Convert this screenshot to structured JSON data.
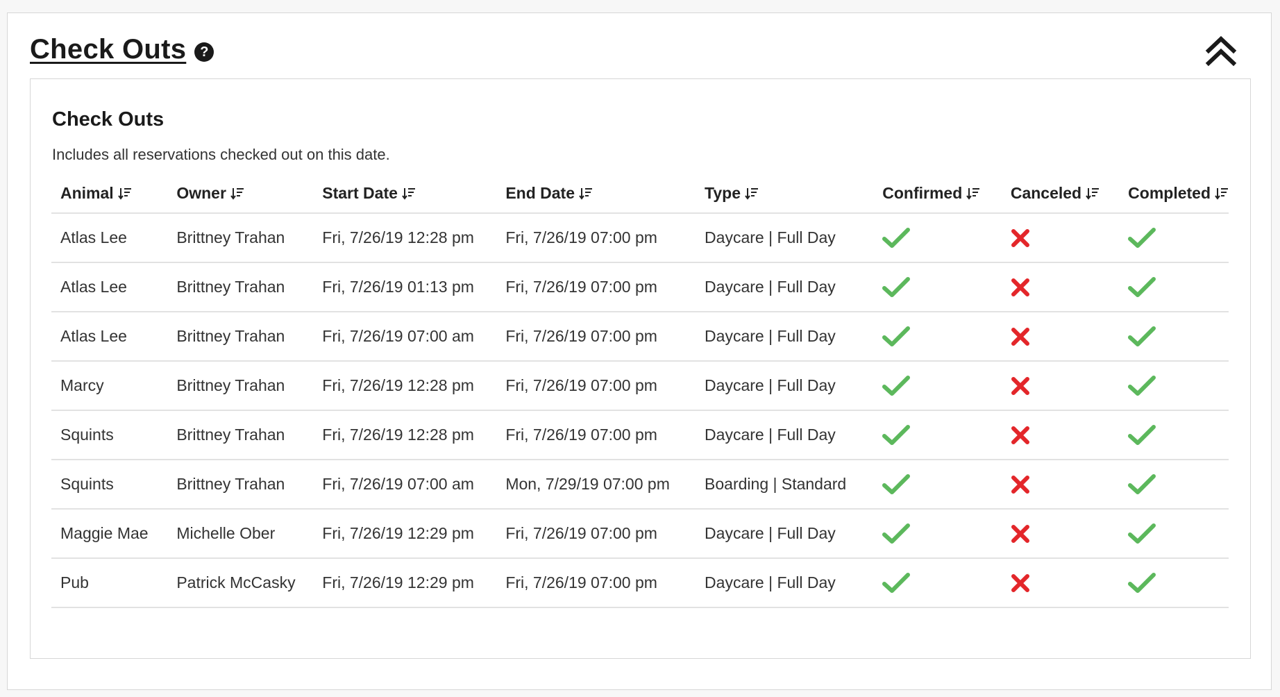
{
  "panel": {
    "title": "Check Outs",
    "help_icon": "?",
    "collapse_icon": "double-chevron-up-icon"
  },
  "card": {
    "title": "Check Outs",
    "subtitle": "Includes all reservations checked out on this date."
  },
  "table": {
    "columns": [
      "Animal",
      "Owner",
      "Start Date",
      "End Date",
      "Type",
      "Confirmed",
      "Canceled",
      "Completed"
    ],
    "rows": [
      {
        "animal": "Atlas Lee",
        "owner": "Brittney Trahan",
        "start": "Fri, 7/26/19 12:28 pm",
        "end": "Fri, 7/26/19 07:00 pm",
        "type": "Daycare | Full Day",
        "confirmed": true,
        "canceled": false,
        "completed": true
      },
      {
        "animal": "Atlas Lee",
        "owner": "Brittney Trahan",
        "start": "Fri, 7/26/19 01:13 pm",
        "end": "Fri, 7/26/19 07:00 pm",
        "type": "Daycare | Full Day",
        "confirmed": true,
        "canceled": false,
        "completed": true
      },
      {
        "animal": "Atlas Lee",
        "owner": "Brittney Trahan",
        "start": "Fri, 7/26/19 07:00 am",
        "end": "Fri, 7/26/19 07:00 pm",
        "type": "Daycare | Full Day",
        "confirmed": true,
        "canceled": false,
        "completed": true
      },
      {
        "animal": "Marcy",
        "owner": "Brittney Trahan",
        "start": "Fri, 7/26/19 12:28 pm",
        "end": "Fri, 7/26/19 07:00 pm",
        "type": "Daycare | Full Day",
        "confirmed": true,
        "canceled": false,
        "completed": true
      },
      {
        "animal": "Squints",
        "owner": "Brittney Trahan",
        "start": "Fri, 7/26/19 12:28 pm",
        "end": "Fri, 7/26/19 07:00 pm",
        "type": "Daycare | Full Day",
        "confirmed": true,
        "canceled": false,
        "completed": true
      },
      {
        "animal": "Squints",
        "owner": "Brittney Trahan",
        "start": "Fri, 7/26/19 07:00 am",
        "end": "Mon, 7/29/19 07:00 pm",
        "type": "Boarding | Standard",
        "confirmed": true,
        "canceled": false,
        "completed": true
      },
      {
        "animal": "Maggie Mae",
        "owner": "Michelle Ober",
        "start": "Fri, 7/26/19 12:29 pm",
        "end": "Fri, 7/26/19 07:00 pm",
        "type": "Daycare | Full Day",
        "confirmed": true,
        "canceled": false,
        "completed": true
      },
      {
        "animal": "Pub",
        "owner": "Patrick McCasky",
        "start": "Fri, 7/26/19 12:29 pm",
        "end": "Fri, 7/26/19 07:00 pm",
        "type": "Daycare | Full Day",
        "confirmed": true,
        "canceled": false,
        "completed": true
      }
    ]
  },
  "icons": {
    "sort": "sort-descending-icon",
    "check": "checkmark-icon",
    "cross": "x-mark-icon"
  },
  "colors": {
    "check": "#5cb85c",
    "cross": "#e3262a",
    "title": "#1a1a1a",
    "border": "#d6d6d6"
  }
}
